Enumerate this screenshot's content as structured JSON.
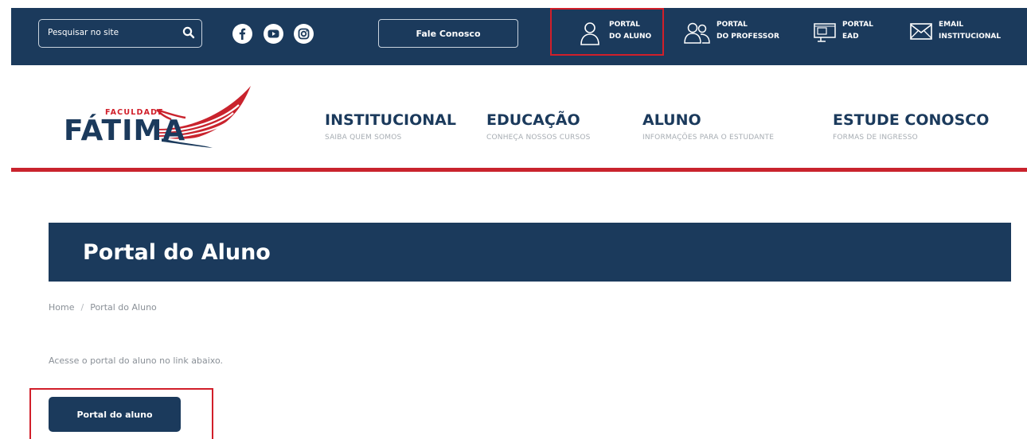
{
  "topbar": {
    "search_placeholder": "Pesquisar no site",
    "search_icon": "search-icon",
    "social_icons": [
      "facebook-icon",
      "youtube-icon",
      "instagram-icon"
    ],
    "fale_label": "Fale Conosco",
    "portals": [
      {
        "line1": "PORTAL",
        "line2": "DO ALUNO",
        "icon": "student-icon",
        "highlighted": true
      },
      {
        "line1": "PORTAL",
        "line2": "DO PROFESSOR",
        "icon": "professor-icon",
        "highlighted": false
      },
      {
        "line1": "PORTAL",
        "line2": "EAD",
        "icon": "ead-icon",
        "highlighted": false
      },
      {
        "line1": "EMAIL",
        "line2": "INSTITUCIONAL",
        "icon": "mail-icon",
        "highlighted": false
      }
    ]
  },
  "logo": {
    "small": "FACULDADE",
    "main": "FÁTIMA"
  },
  "nav": [
    {
      "title": "INSTITUCIONAL",
      "subtitle": "SAIBA QUEM SOMOS"
    },
    {
      "title": "EDUCAÇÃO",
      "subtitle": "CONHEÇA NOSSOS CURSOS"
    },
    {
      "title": "ALUNO",
      "subtitle": "INFORMAÇÕES PARA O ESTUDANTE"
    },
    {
      "title": "ESTUDE CONOSCO",
      "subtitle": "FORMAS DE INGRESSO"
    }
  ],
  "page": {
    "title": "Portal do Aluno",
    "breadcrumb": [
      "Home",
      "Portal do Aluno"
    ],
    "breadcrumb_separator": "/",
    "intro": "Acesse o portal do aluno no link abaixo.",
    "button_label": "Portal do aluno"
  },
  "colors": {
    "navy": "#1b3a5c",
    "red": "#c9232d",
    "highlight": "#d11f2a",
    "muted_text": "#8a9097"
  }
}
